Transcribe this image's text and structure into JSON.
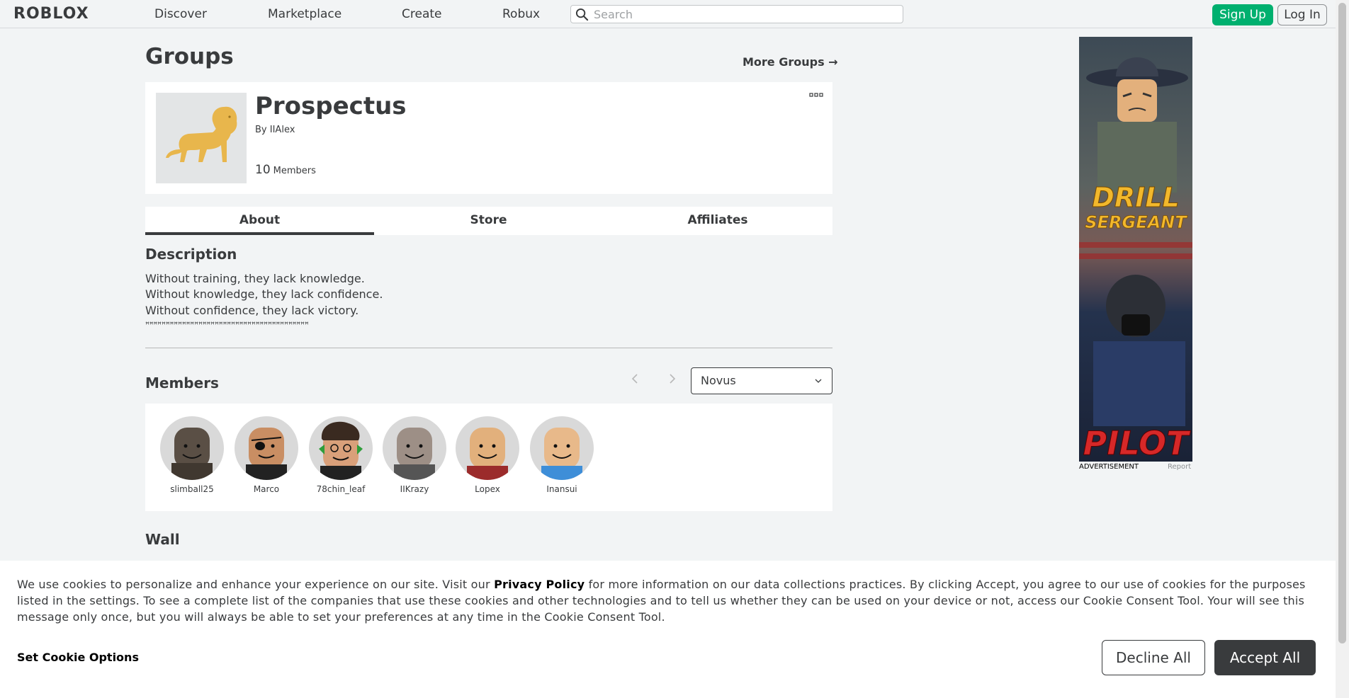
{
  "nav": {
    "logo": "ROBLOX",
    "links": [
      "Discover",
      "Marketplace",
      "Create",
      "Robux"
    ],
    "search_placeholder": "Search",
    "signup": "Sign Up",
    "login": "Log In"
  },
  "page": {
    "title": "Groups",
    "more_groups": "More Groups →"
  },
  "group": {
    "name": "Prospectus",
    "by_label": "By",
    "owner": "IIAlex",
    "member_count": "10",
    "member_label": "Members"
  },
  "tabs": [
    "About",
    "Store",
    "Affiliates"
  ],
  "description": {
    "heading": "Description",
    "lines": [
      "Without training, they lack knowledge.",
      "Without knowledge, they lack confidence.",
      "Without confidence, they lack victory.",
      "ꟸꟸꟸꟸꟸꟸꟸꟸꟸꟸꟸꟸꟸꟸꟸꟸꟸꟸꟸꟸꟸꟸꟸꟸꟸꟸꟸꟸꟸꟸꟸꟸꟸꟸꟸꟸꟸꟸꟸꟸ"
    ]
  },
  "members": {
    "heading": "Members",
    "role_selected": "Novus",
    "list": [
      "slimball25",
      "Marco",
      "78chin_leaf",
      "IIKrazy",
      "Lopex",
      "Inansui"
    ]
  },
  "wall": {
    "heading": "Wall"
  },
  "ad": {
    "label": "ADVERTISEMENT",
    "report": "Report",
    "line1": "DRILL",
    "line2": "SERGEANT",
    "line3": "PILOT"
  },
  "cookie": {
    "text_before": "We use cookies to personalize and enhance your experience on our site. Visit our ",
    "policy_link": "Privacy Policy",
    "text_after": " for more information on our data collections practices. By clicking Accept, you agree to our use of cookies for the purposes listed in the settings. To see a complete list of the companies that use these cookies and other technologies and to tell us whether they can be used on your device or not, access our Cookie Consent Tool. Your will see this message only once, but you will always be able to set your preferences at any time in the Cookie Consent Tool.",
    "set_options": "Set Cookie Options",
    "decline": "Decline All",
    "accept": "Accept All"
  }
}
